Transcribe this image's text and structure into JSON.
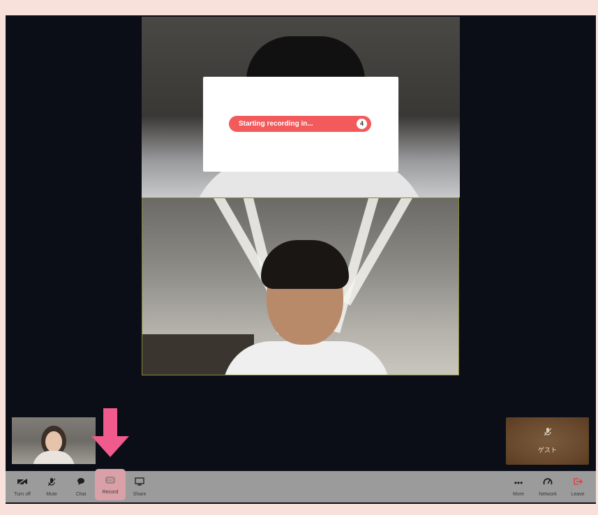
{
  "modal": {
    "recording_text": "Starting recording in...",
    "countdown": "4"
  },
  "guest_tile": {
    "name": "ゲスト",
    "icon": "mic-muted-icon"
  },
  "toolbar": {
    "left": [
      {
        "label": "Turn off",
        "icon": "video-off-icon"
      },
      {
        "label": "Mute",
        "icon": "mic-muted-icon"
      },
      {
        "label": "Chat",
        "icon": "chat-icon"
      },
      {
        "label": "Record",
        "icon": "record-icon"
      },
      {
        "label": "Share",
        "icon": "share-screen-icon"
      }
    ],
    "right": [
      {
        "label": "More",
        "icon": "more-icon"
      },
      {
        "label": "Network",
        "icon": "network-gauge-icon"
      },
      {
        "label": "Leave",
        "icon": "leave-icon"
      }
    ]
  },
  "colors": {
    "record_pill": "#f25a5c",
    "highlight_arrow": "#f05a8c",
    "leave": "#e04444"
  }
}
